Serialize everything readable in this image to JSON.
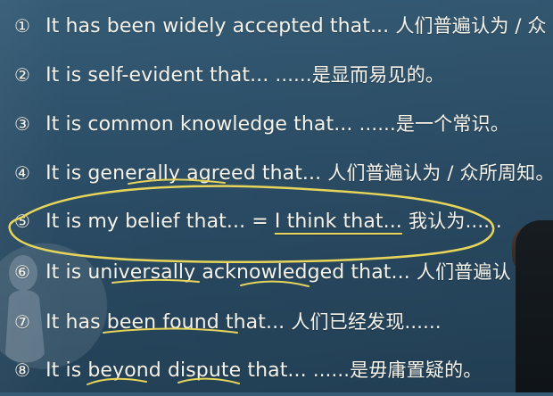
{
  "lines": [
    {
      "num": "①",
      "en": "It has been widely accepted that...",
      "cn": "人们普遍认为 / 众"
    },
    {
      "num": "②",
      "en": "It is self-evident that...",
      "cn": "......是显而易见的。"
    },
    {
      "num": "③",
      "en": "It is common knowledge that...",
      "cn": "......是一个常识。"
    },
    {
      "num": "④",
      "en": "It is generally agreed that...",
      "cn": "人们普遍认为 / 众所周知。"
    },
    {
      "num": "⑤",
      "en": "It is my belief that...",
      "eq": "=",
      "alt": "I think that...",
      "cn": "我认为......"
    },
    {
      "num": "⑥",
      "en": "It is universally acknowledged that...",
      "cn": "人们普遍认"
    },
    {
      "num": "⑦",
      "en": "It has been found that...",
      "cn": "人们已经发现......"
    },
    {
      "num": "⑧",
      "en": "It is beyond dispute that...",
      "cn": "......是毋庸置疑的。"
    }
  ],
  "colors": {
    "background": "#2f536d",
    "text": "#f6f3ea",
    "annotation": "#e6d55a"
  }
}
